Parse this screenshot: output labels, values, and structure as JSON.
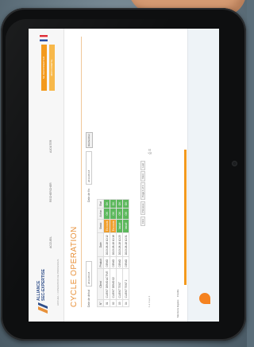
{
  "logo": {
    "line1": "ALLIANCE",
    "line2": "SEC-EXPERTISE"
  },
  "top_menu": [
    "ACCUEIL",
    "RECHERCHER",
    "AJOUTER"
  ],
  "breadcrumb": "ACCUEIL > OPERATION DE PROCESSUS",
  "user_buttons": [
    "SE DECONNECTER",
    "MON COMPTE"
  ],
  "page_title": "CYCLE OPERATION",
  "filters": {
    "date_from_label": "Date de début",
    "date_from": "2013-08-18",
    "date_to_label": "Date de fin",
    "date_to": "2013-08-18",
    "search_label": "Rechercher"
  },
  "table": {
    "headers": [
      "N°",
      "Client",
      "Produit",
      "Date",
      "Statut",
      "Action",
      "Etat"
    ],
    "rows": [
      [
        "01",
        "CLIENT DEMO ACTIVE",
        "DEMO",
        "2013-08-18 10:12",
        "En cours",
        "OK",
        "OK"
      ],
      [
        "02",
        "CLIENT DEMO 02",
        "DEMO",
        "2013-08-18 10:18",
        "En cours",
        "OK",
        "OK"
      ],
      [
        "03",
        "CLIENT TEST",
        "DEMO",
        "2013-08-18 10:25",
        "Validé",
        "OK",
        "OK"
      ],
      [
        "04",
        "CLIENT TEST 2",
        "DEMO",
        "2013-08-18 10:31",
        "Validé",
        "OK",
        "OK"
      ]
    ]
  },
  "pager": [
    "First",
    "Previous",
    "Page 1 of 1",
    "Next",
    "Last"
  ],
  "results_label": "1 à 4 sur 4",
  "footer_links": [
    "Mentions légales",
    "Crédits"
  ],
  "colors": {
    "accent": "#f39a1e",
    "title": "#e8913a",
    "status_ok": "#5cb85c",
    "status_pending": "#f0a030",
    "brand_blue": "#2f4e8a"
  }
}
